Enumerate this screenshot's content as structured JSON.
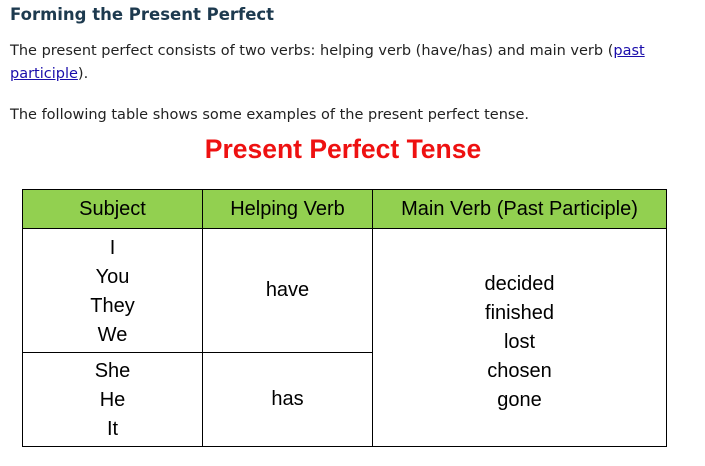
{
  "heading": "Forming the Present Perfect",
  "paragraph1": {
    "text_before": "The present perfect consists of two verbs: helping verb (have/has) and main verb (",
    "link_text": "past participle",
    "text_after": ")."
  },
  "paragraph2": "The following table shows some examples of the present perfect tense.",
  "table_title": "Present Perfect Tense",
  "table": {
    "headers": [
      "Subject",
      "Helping Verb",
      "Main Verb (Past Participle)"
    ],
    "group1": {
      "subjects": [
        "I",
        "You",
        "They",
        "We"
      ],
      "helping_verb": "have"
    },
    "group2": {
      "subjects": [
        "She",
        "He",
        "It"
      ],
      "helping_verb": "has"
    },
    "main_verbs": [
      "decided",
      "finished",
      "lost",
      "chosen",
      "gone"
    ]
  }
}
